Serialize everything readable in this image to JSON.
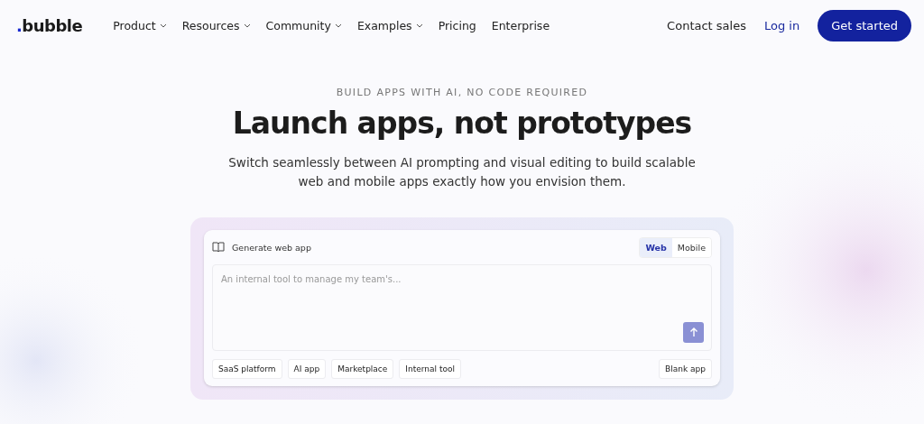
{
  "nav": {
    "logo": {
      "dot": ".",
      "text": "bubble"
    },
    "items": [
      {
        "label": "Product",
        "dropdown": true
      },
      {
        "label": "Resources",
        "dropdown": true
      },
      {
        "label": "Community",
        "dropdown": true
      },
      {
        "label": "Examples",
        "dropdown": true
      },
      {
        "label": "Pricing",
        "dropdown": false
      },
      {
        "label": "Enterprise",
        "dropdown": false
      }
    ],
    "contact": "Contact sales",
    "login": "Log in",
    "cta": "Get started"
  },
  "hero": {
    "eyebrow": "BUILD APPS WITH AI, NO CODE REQUIRED",
    "title": "Launch apps, not prototypes",
    "subtitle": "Switch seamlessly between AI prompting and visual editing to build scalable web and mobile apps exactly how you envision them."
  },
  "generator": {
    "label": "Generate web app",
    "modes": [
      {
        "label": "Web",
        "selected": true
      },
      {
        "label": "Mobile",
        "selected": false
      }
    ],
    "prompt": {
      "placeholder": "An internal tool to manage my team's..."
    },
    "suggestions": [
      "SaaS platform",
      "AI app",
      "Marketplace",
      "Internal tool"
    ],
    "blank": "Blank app"
  }
}
